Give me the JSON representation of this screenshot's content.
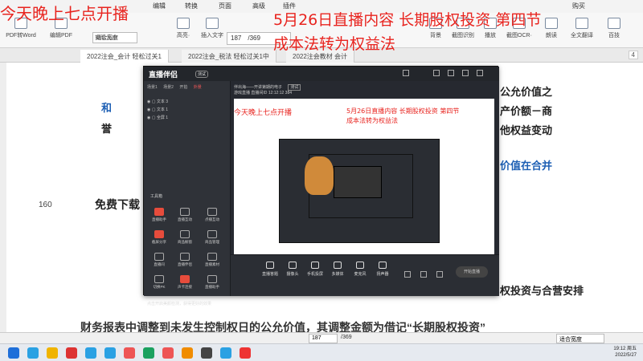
{
  "overlay": {
    "left_title": "今天晚上七点开播",
    "right_title_line1": "5月26日直播内容 长期股权投资 第四节",
    "right_title_line2": "成本法转为权益法",
    "mini_left": "今天晚上七点开播",
    "mini_right1": "5月26日直播内容 长期股权投资 第四节",
    "mini_right2": "成本法转为权益法"
  },
  "menubar": {
    "items": [
      "编辑",
      "转换",
      "页面",
      "高级",
      "插件"
    ],
    "right": "购买"
  },
  "toolbar": {
    "buttons": [
      "PDF转Word",
      "编辑PDF",
      "实际大小",
      "高亮·",
      "插入文字"
    ],
    "zoom": "适合宽度",
    "page_current": "187",
    "page_total": "/369",
    "right_buttons": [
      "背景",
      "截图识别",
      "播放",
      "截图OCR·",
      "朗读",
      "全文翻译",
      "百技"
    ]
  },
  "tabs": {
    "items": [
      "2022注会_会计 轻松过关1",
      "2022注会_税法 轻松过关1中",
      "2022注会教材 会计"
    ],
    "count": "4"
  },
  "document": {
    "line_number": "160",
    "free_download": "免费下载",
    "right_texts": [
      "公允价值之",
      "产价额－商",
      "他权益变动",
      "价值在合并",
      "权投资与合营安排"
    ],
    "left_texts": [
      "和",
      "誉"
    ],
    "bottom_line": "财务报表中调整到未发生控制权日的公允价值，其调整金额为借记“长期股权投资”"
  },
  "recorder": {
    "logo": "直播伴侣",
    "badge": "测试",
    "source_tabs": [
      "场景1",
      "场景2",
      "开拍",
      "外景"
    ],
    "sources": [
      "文本 3",
      "文本 1",
      "全屏 1"
    ],
    "tool_title": "工具箱",
    "tools": [
      "直播助手",
      "直播互动",
      "点播互动",
      "截屏分享",
      "商品橱窗",
      "商品管理",
      "直播间",
      "直播伴侣",
      "直播素材",
      "切换PK",
      "声卡连接",
      "直播助手"
    ],
    "tip": "点击开启美颜检测，获得更好的效果",
    "live_title": "伴出海——开讲第期的电子",
    "live_tag": "测试",
    "live_meta": [
      "游戏直播",
      "直播间ID",
      "12:12:12",
      "384"
    ],
    "bottom_buttons": [
      "直播答题",
      "摄像头",
      "手机投屏",
      "多媒体",
      "麦克风",
      "扬声器"
    ],
    "start": "开始直播"
  },
  "statusbar": {
    "page_current": "187",
    "page_total": "/369",
    "zoom": "适合宽度"
  },
  "taskbar": {
    "time": "19:12 周五",
    "date": "2022/5/27"
  }
}
